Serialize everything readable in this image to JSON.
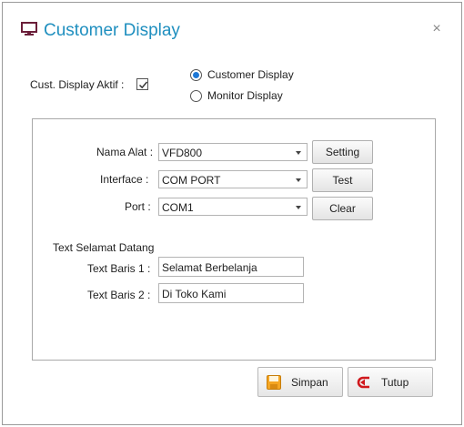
{
  "window": {
    "title": "Customer Display",
    "icon": "monitor-icon",
    "accent": "#1f8fbf"
  },
  "top": {
    "cust_display_label": "Cust. Display Aktif :",
    "cust_display_checked": true,
    "radio_customer_label": "Customer Display",
    "radio_monitor_label": "Monitor Display",
    "selected_mode": "Customer Display"
  },
  "group": {
    "nama_alat_label": "Nama Alat :",
    "nama_alat_value": "VFD800",
    "interface_label": "Interface :",
    "interface_value": "COM PORT",
    "port_label": "Port :",
    "port_value": "COM1",
    "setting_button": "Setting",
    "test_button": "Test",
    "clear_button": "Clear",
    "welcome_heading": "Text Selamat Datang",
    "baris1_label": "Text Baris 1 :",
    "baris1_value": "Selamat Berbelanja",
    "baris2_label": "Text Baris 2 :",
    "baris2_value": "Di Toko Kami"
  },
  "footer": {
    "simpan_label": "Simpan",
    "tutup_label": "Tutup"
  }
}
